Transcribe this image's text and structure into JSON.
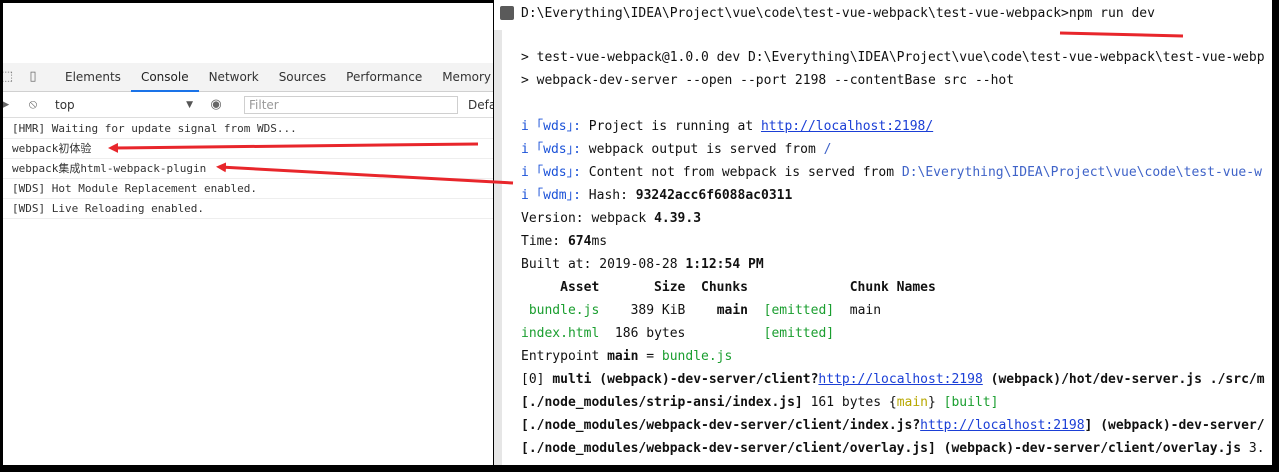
{
  "devtools": {
    "tabs": [
      "Elements",
      "Console",
      "Network",
      "Sources",
      "Performance",
      "Memory"
    ],
    "active_tab": "Console",
    "context": "top",
    "filter_placeholder": "Filter",
    "levels": "Defa",
    "console_lines": [
      "[HMR] Waiting for update signal from WDS...",
      "webpack初体验",
      "webpack集成html-webpack-plugin",
      "[WDS] Hot Module Replacement enabled.",
      "[WDS] Live Reloading enabled."
    ]
  },
  "terminal": {
    "title": "D:\\Everything\\IDEA\\Project\\vue\\code\\test-vue-webpack\\test-vue-webpack>npm run dev",
    "lines": {
      "l1": "> test-vue-webpack@1.0.0 dev D:\\Everything\\IDEA\\Project\\vue\\code\\test-vue-webpack\\test-vue-webp",
      "l2": "> webpack-dev-server --open --port 2198 --contentBase src --hot",
      "wds_prefix": "i ｢wds｣: ",
      "wdm_prefix": "i ｢wdm｣: ",
      "running_text": "Project is running at ",
      "running_url": "http://localhost:2198/",
      "output_text": "webpack output is served from ",
      "output_path": "/",
      "content_text": "Content not from webpack is served from ",
      "content_path": "D:\\Everything\\IDEA\\Project\\vue\\code\\test-vue-w",
      "hash_label": "Hash: ",
      "hash_value": "93242acc6f6088ac0311",
      "version_label": "Version: webpack ",
      "version_value": "4.39.3",
      "time_label": "Time: ",
      "time_value": "674",
      "time_unit": "ms",
      "built_label": "Built at: 2019-08-28 ",
      "built_value": "1:12:54 PM",
      "table_header": "     Asset       Size  Chunks             Chunk Names",
      "row1_asset": " bundle.js",
      "row1_size": "    389 KiB",
      "row1_chunk": "main",
      "row1_emitted": "[emitted]",
      "row1_name": "main",
      "row2_asset": "index.html",
      "row2_size": "  186 bytes",
      "row2_emitted": "[emitted]",
      "entry_label": "Entrypoint ",
      "entry_main": "main",
      "entry_eq": " = ",
      "entry_file": "bundle.js",
      "m0_a": "[0] ",
      "m0_b": "multi (webpack)-dev-server/client?",
      "m0_url": "http://localhost:2198",
      "m0_c": " (webpack)/hot/dev-server.js ./src/m",
      "m1_a": "[./node_modules/strip-ansi/index.js]",
      "m1_b": " 161 bytes {",
      "m1_main": "main",
      "m1_c": "} ",
      "m1_built": "[built]",
      "m2_a": "[./node_modules/webpack-dev-server/client/index.js?",
      "m2_url": "http://localhost:2198",
      "m2_b": "] ",
      "m2_c": "(webpack)-dev-server/",
      "m3_a": "[./node_modules/webpack-dev-server/client/overlay.js]",
      "m3_b": " (webpack)-dev-server/client/overlay.js",
      "m3_c": " 3."
    }
  },
  "colors": {
    "annotation_red": "#e8262b",
    "link_blue": "#1b3fd6",
    "green": "#1a9e2f",
    "active_tab_underline": "#1a73e8"
  }
}
